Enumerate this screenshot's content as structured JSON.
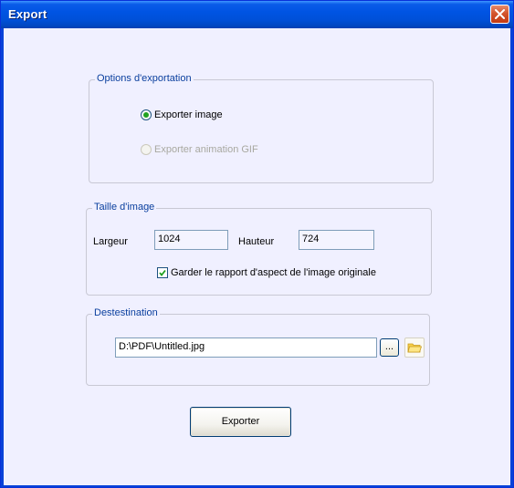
{
  "window": {
    "title": "Export"
  },
  "export_options": {
    "label": "Options d'exportation",
    "radio_image_label": "Exporter image",
    "radio_gif_label": "Exporter animation GIF"
  },
  "image_size": {
    "label": "Taille d'image",
    "width_label": "Largeur",
    "width_value": "1024",
    "height_label": "Hauteur",
    "height_value": "724",
    "keep_aspect_label": "Garder le rapport d'aspect de l'image originale"
  },
  "destination": {
    "label": "Destestination",
    "path": "D:\\PDF\\Untitled.jpg",
    "browse_label": "..."
  },
  "footer": {
    "export_label": "Exporter"
  },
  "colors": {
    "titlebar": "#0054e3",
    "client": "#f0f0ff",
    "group_label": "#0a3f9e"
  }
}
